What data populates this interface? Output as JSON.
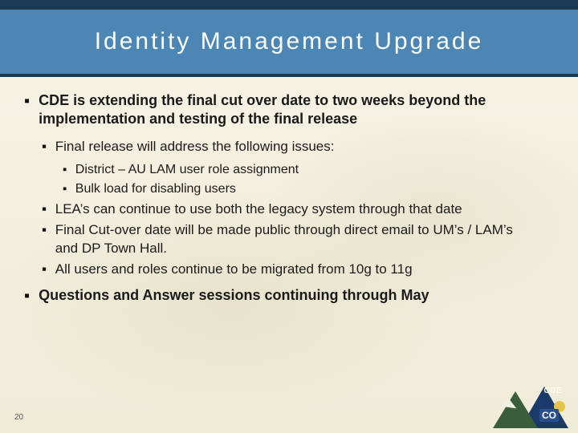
{
  "header": {
    "title": "Identity Management Upgrade"
  },
  "content": {
    "b1a": "CDE is extending the final cut over date to two weeks beyond the implementation and testing of the final release",
    "b2a": "Final release will address the following issues:",
    "b3a": "District – AU LAM user role assignment",
    "b3b": "Bulk load for disabling users",
    "b2b": "LEA’s can continue to use both the legacy system through that date",
    "b2c": "Final Cut-over date will be made public through direct email to UM’s / LAM’s and DP Town Hall.",
    "b2d": "All users and roles continue to be migrated from 10g to 11g",
    "b1b": "Questions and Answer sessions continuing through May"
  },
  "footer": {
    "page_number": "20",
    "logo_top": "CDE",
    "logo_bottom": "CO"
  }
}
